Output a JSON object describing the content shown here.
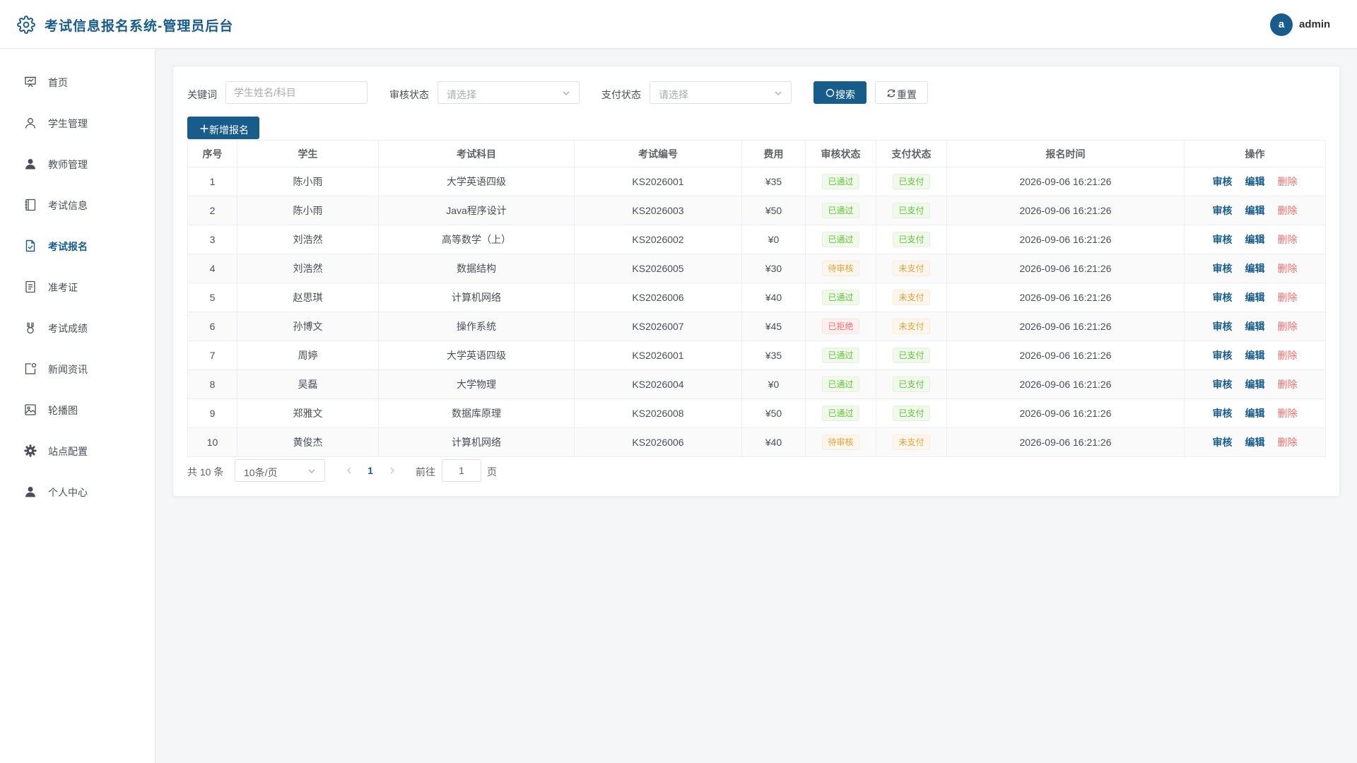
{
  "header": {
    "title": "考试信息报名系统-管理员后台",
    "avatar_letter": "a",
    "username": "admin"
  },
  "sidebar": {
    "items": [
      {
        "label": "首页",
        "icon": "presentation-board-icon"
      },
      {
        "label": "学生管理",
        "icon": "user-outline-icon"
      },
      {
        "label": "教师管理",
        "icon": "user-filled-icon"
      },
      {
        "label": "考试信息",
        "icon": "notebook-icon"
      },
      {
        "label": "考试报名",
        "icon": "document-checked-icon",
        "active": true
      },
      {
        "label": "准考证",
        "icon": "tickets-icon"
      },
      {
        "label": "考试成绩",
        "icon": "medal-icon"
      },
      {
        "label": "新闻资讯",
        "icon": "news-icon"
      },
      {
        "label": "轮播图",
        "icon": "picture-icon"
      },
      {
        "label": "站点配置",
        "icon": "gear-icon"
      },
      {
        "label": "个人中心",
        "icon": "user-filled-icon"
      }
    ]
  },
  "filters": {
    "keyword_label": "关键词",
    "keyword_placeholder": "学生姓名/科目",
    "keyword_value": "",
    "audit_label": "审核状态",
    "audit_placeholder": "请选择",
    "pay_label": "支付状态",
    "pay_placeholder": "请选择",
    "search_label": "搜索",
    "reset_label": "重置"
  },
  "add_button_label": "新增报名",
  "table": {
    "columns": [
      "序号",
      "学生",
      "考试科目",
      "考试编号",
      "费用",
      "审核状态",
      "支付状态",
      "报名时间",
      "操作"
    ],
    "actions": {
      "audit": "审核",
      "edit": "编辑",
      "delete": "删除"
    },
    "rows": [
      {
        "no": "1",
        "student": "陈小雨",
        "subject": "大学英语四级",
        "code": "KS2026001",
        "fee": "¥35",
        "audit": "已通过",
        "audit_type": "success",
        "pay": "已支付",
        "pay_type": "success",
        "time": "2026-09-06 16:21:26"
      },
      {
        "no": "2",
        "student": "陈小雨",
        "subject": "Java程序设计",
        "code": "KS2026003",
        "fee": "¥50",
        "audit": "已通过",
        "audit_type": "success",
        "pay": "已支付",
        "pay_type": "success",
        "time": "2026-09-06 16:21:26"
      },
      {
        "no": "3",
        "student": "刘浩然",
        "subject": "高等数学（上）",
        "code": "KS2026002",
        "fee": "¥0",
        "audit": "已通过",
        "audit_type": "success",
        "pay": "已支付",
        "pay_type": "success",
        "time": "2026-09-06 16:21:26"
      },
      {
        "no": "4",
        "student": "刘浩然",
        "subject": "数据结构",
        "code": "KS2026005",
        "fee": "¥30",
        "audit": "待审核",
        "audit_type": "warning",
        "pay": "未支付",
        "pay_type": "warning",
        "time": "2026-09-06 16:21:26"
      },
      {
        "no": "5",
        "student": "赵思琪",
        "subject": "计算机网络",
        "code": "KS2026006",
        "fee": "¥40",
        "audit": "已通过",
        "audit_type": "success",
        "pay": "未支付",
        "pay_type": "warning",
        "time": "2026-09-06 16:21:26"
      },
      {
        "no": "6",
        "student": "孙博文",
        "subject": "操作系统",
        "code": "KS2026007",
        "fee": "¥45",
        "audit": "已拒绝",
        "audit_type": "danger",
        "pay": "未支付",
        "pay_type": "warning",
        "time": "2026-09-06 16:21:26"
      },
      {
        "no": "7",
        "student": "周婷",
        "subject": "大学英语四级",
        "code": "KS2026001",
        "fee": "¥35",
        "audit": "已通过",
        "audit_type": "success",
        "pay": "已支付",
        "pay_type": "success",
        "time": "2026-09-06 16:21:26"
      },
      {
        "no": "8",
        "student": "吴磊",
        "subject": "大学物理",
        "code": "KS2026004",
        "fee": "¥0",
        "audit": "已通过",
        "audit_type": "success",
        "pay": "已支付",
        "pay_type": "success",
        "time": "2026-09-06 16:21:26"
      },
      {
        "no": "9",
        "student": "郑雅文",
        "subject": "数据库原理",
        "code": "KS2026008",
        "fee": "¥50",
        "audit": "已通过",
        "audit_type": "success",
        "pay": "已支付",
        "pay_type": "success",
        "time": "2026-09-06 16:21:26"
      },
      {
        "no": "10",
        "student": "黄俊杰",
        "subject": "计算机网络",
        "code": "KS2026006",
        "fee": "¥40",
        "audit": "待审核",
        "audit_type": "warning",
        "pay": "未支付",
        "pay_type": "warning",
        "time": "2026-09-06 16:21:26"
      }
    ]
  },
  "pagination": {
    "total_text": "共 10 条",
    "page_size": "10条/页",
    "current_page": "1",
    "goto_label": "前往",
    "goto_value": "1",
    "page_suffix": "页"
  },
  "colors": {
    "primary": "#185c8b",
    "success": "#67c23a",
    "warning": "#e6a23c",
    "danger": "#f56c6c"
  }
}
